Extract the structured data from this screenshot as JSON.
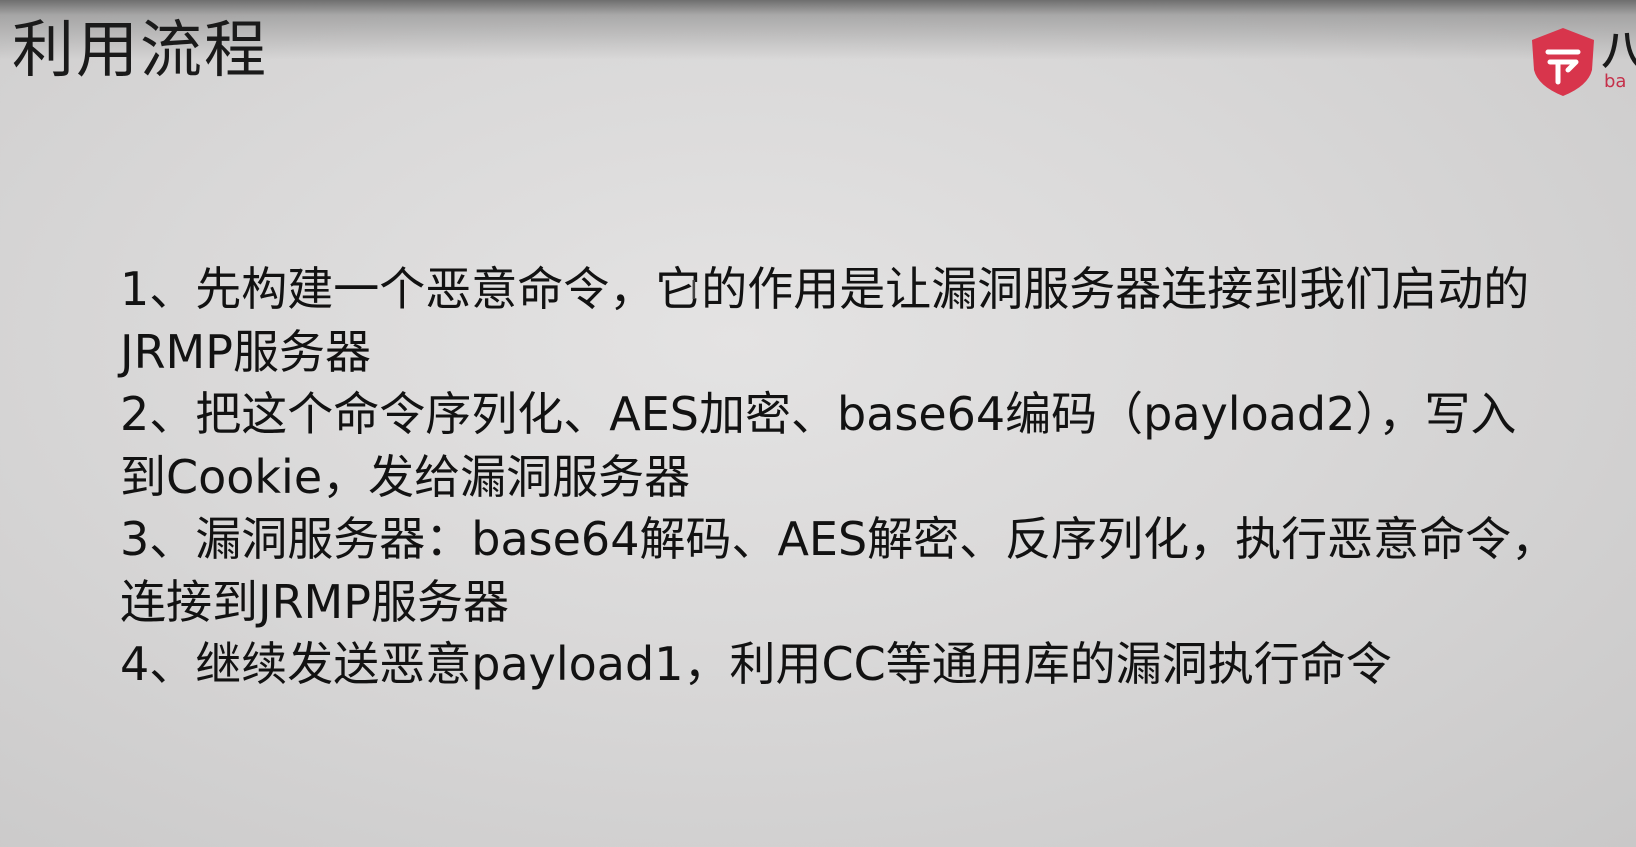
{
  "slide": {
    "title": "利用流程",
    "brand": {
      "name_fragment": "八",
      "sub_fragment": "ba",
      "logo_color": "#d8354c",
      "logo_icon": "shield-logo-icon"
    },
    "steps": [
      "1、先构建一个恶意命令，它的作用是让漏洞服务器连接到我们启动的JRMP服务器",
      "2、把这个命令序列化、AES加密、base64编码（payload2），写入到Cookie，发给漏洞服务器",
      "3、漏洞服务器：base64解码、AES解密、反序列化，执行恶意命令，连接到JRMP服务器",
      "4、继续发送恶意payload1，利用CC等通用库的漏洞执行命令"
    ]
  }
}
